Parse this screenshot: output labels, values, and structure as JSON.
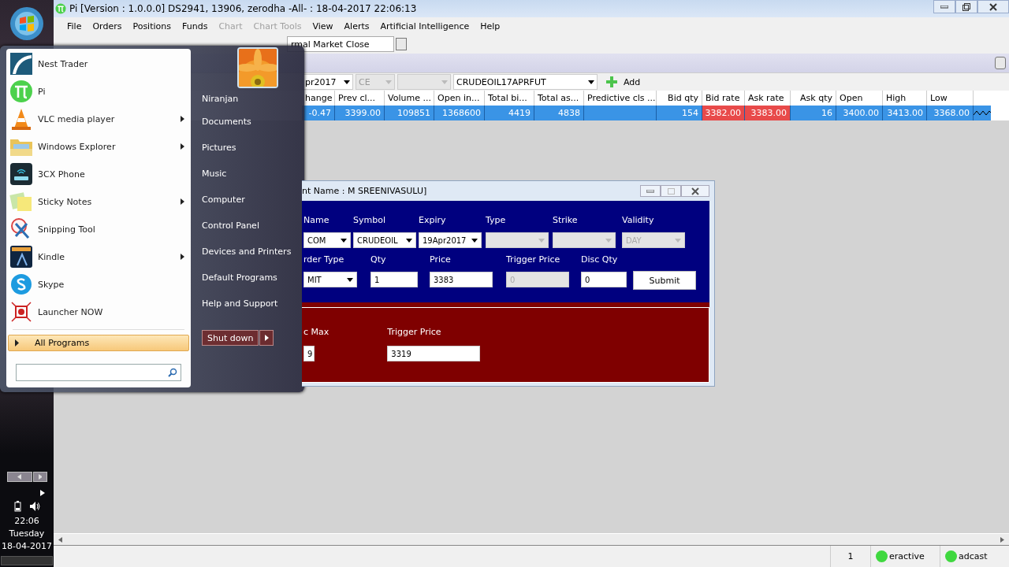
{
  "window": {
    "title": "Pi [Version : 1.0.0.0] DS2941, 13906, zerodha -All- : 18-04-2017 22:06:13"
  },
  "menu": [
    {
      "label": "File",
      "disabled": false
    },
    {
      "label": "Orders",
      "disabled": false
    },
    {
      "label": "Positions",
      "disabled": false
    },
    {
      "label": "Funds",
      "disabled": false
    },
    {
      "label": "Chart",
      "disabled": true
    },
    {
      "label": "Chart Tools",
      "disabled": true
    },
    {
      "label": "View",
      "disabled": false
    },
    {
      "label": "Alerts",
      "disabled": false
    },
    {
      "label": "Artificial Intelligence",
      "disabled": false
    },
    {
      "label": "Help",
      "disabled": false
    }
  ],
  "market_status": {
    "value": "rmal Market Close"
  },
  "filters": [
    {
      "value": "pr2017",
      "disabled": false
    },
    {
      "value": "CE",
      "disabled": true
    },
    {
      "disabled": true
    },
    {
      "value": "CRUDEOIL17APRFUT",
      "disabled": false
    }
  ],
  "add_button": {
    "label": "Add"
  },
  "table": {
    "columns": [
      "hange",
      "Prev cl...",
      "Volume ...",
      "Open in...",
      "Total bi...",
      "Total as...",
      "Predictive cls ...",
      "Bid qty",
      "Bid rate",
      "Ask rate",
      "Ask qty",
      "Open",
      "High",
      "Low"
    ],
    "rows": [
      {
        "selected": true,
        "cells": [
          {
            "text": "-0.47"
          },
          {
            "text": "3399.00"
          },
          {
            "text": "109851"
          },
          {
            "text": "1368600"
          },
          {
            "text": "4419"
          },
          {
            "text": "4838"
          },
          {},
          {
            "text": "154"
          },
          {
            "text": "3382.00",
            "color": "#e84a4a"
          },
          {
            "text": "3383.00",
            "color": "#e84a4a"
          },
          {
            "text": "16"
          },
          {
            "text": "3400.00"
          },
          {
            "text": "3413.00"
          },
          {
            "text": "3368.00"
          }
        ]
      }
    ]
  },
  "status_bar": {
    "count": "1",
    "items": [
      {
        "text": "eractive",
        "color": "#3fd83f"
      },
      {
        "text": "adcast",
        "color": "#3fd83f"
      }
    ]
  },
  "start_menu": {
    "programs": [
      {
        "label": "Nest Trader",
        "submenu": false
      },
      {
        "label": "Pi",
        "submenu": false
      },
      {
        "label": "VLC media player",
        "submenu": true
      },
      {
        "label": "Windows Explorer",
        "submenu": true
      },
      {
        "label": "3CX Phone",
        "submenu": false
      },
      {
        "label": "Sticky Notes",
        "submenu": true
      },
      {
        "label": "Snipping Tool",
        "submenu": false
      },
      {
        "label": "Kindle",
        "submenu": true
      },
      {
        "label": "Skype",
        "submenu": false
      },
      {
        "label": "Launcher NOW",
        "submenu": false
      }
    ],
    "all_programs": "All Programs",
    "user": "Niranjan",
    "places": [
      "Documents",
      "Pictures",
      "Music",
      "Computer",
      "Control Panel",
      "Devices and Printers",
      "Default Programs",
      "Help and Support"
    ],
    "shutdown": "Shut down"
  },
  "order_window": {
    "title": "nt Name : M SREENIVASULU]",
    "row1": [
      {
        "label": "Name",
        "value": "COM",
        "disabled": false
      },
      {
        "label": "Symbol",
        "value": "CRUDEOIL",
        "disabled": false
      },
      {
        "label": "Expiry",
        "value": "19Apr2017",
        "disabled": false
      },
      {
        "label": "Type",
        "disabled": true
      },
      {
        "label": "Strike",
        "disabled": true
      },
      {
        "label": "Validity",
        "value": "DAY",
        "disabled": true
      }
    ],
    "row2": [
      {
        "label": "rder Type",
        "value": "MIT",
        "kind": "dropdown",
        "disabled": false
      },
      {
        "label": "Qty",
        "value": "1",
        "kind": "input",
        "disabled": false
      },
      {
        "label": "Price",
        "value": "3383",
        "kind": "input",
        "disabled": false
      },
      {
        "label": "Trigger Price",
        "value": "0",
        "kind": "input",
        "disabled": true
      },
      {
        "label": "Disc Qty",
        "value": "0",
        "kind": "input",
        "disabled": false
      }
    ],
    "submit": "Submit",
    "lower": [
      {
        "label": "c Max",
        "value": "9"
      },
      {
        "label": "Trigger Price",
        "value": "3319"
      }
    ]
  },
  "clock": {
    "time": "22:06",
    "day": "Tuesday",
    "date": "18-04-2017"
  }
}
